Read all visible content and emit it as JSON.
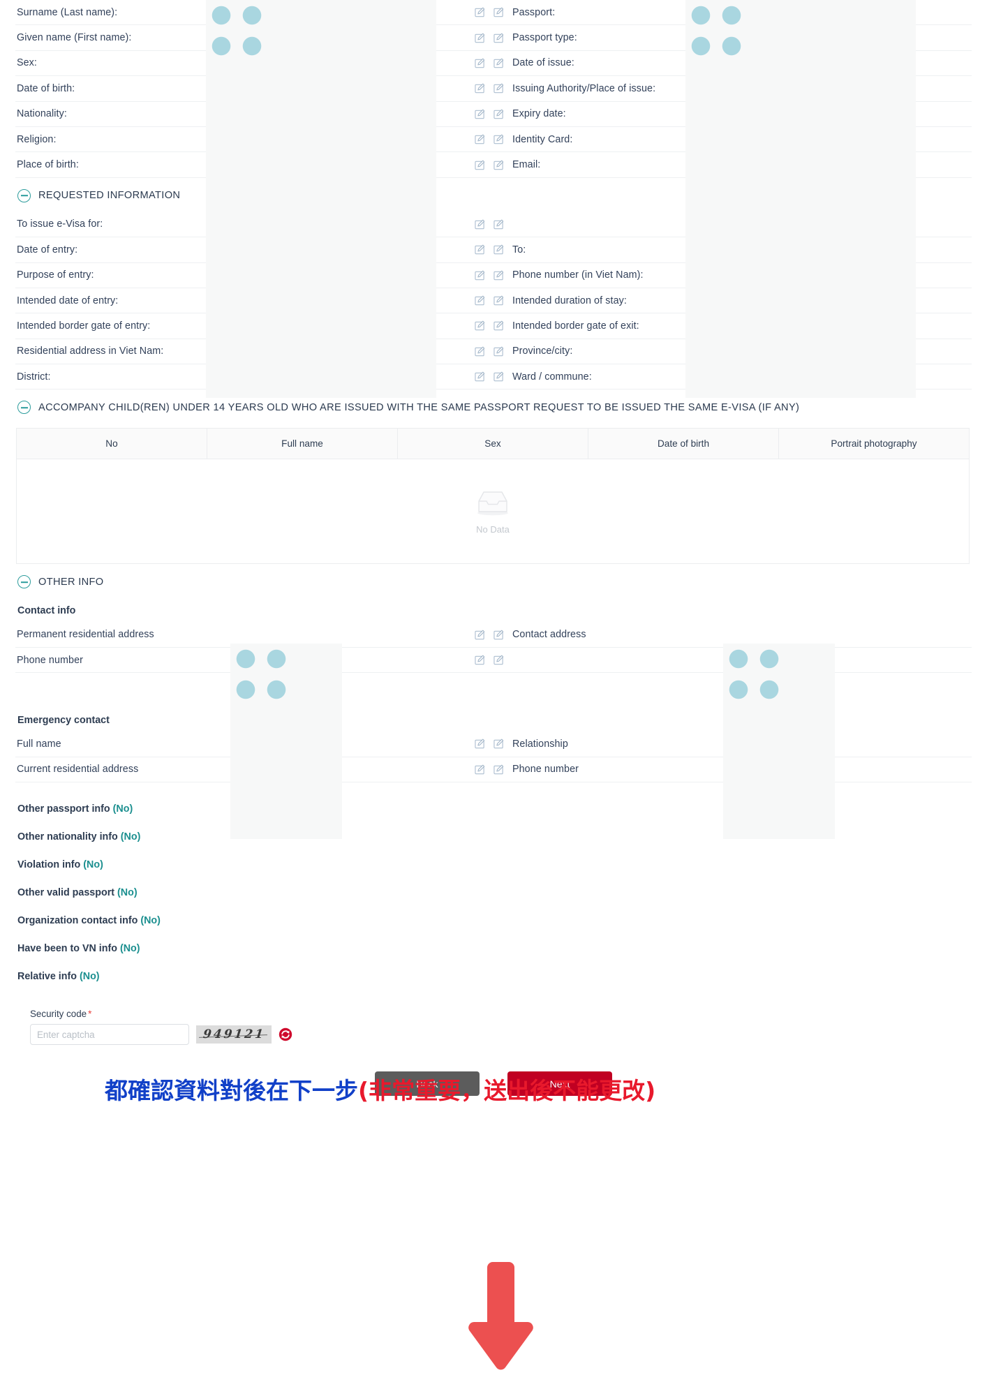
{
  "personal_left": [
    "Surname (Last name):",
    "Given name (First name):",
    "Sex:",
    "Date of birth:",
    "Nationality:",
    "Religion:",
    "Place of birth:"
  ],
  "personal_right": [
    "Passport:",
    "Passport type:",
    "Date of issue:",
    "Issuing Authority/Place of issue:",
    "Expiry date:",
    "Identity Card:",
    "Email:"
  ],
  "requested_section": {
    "title": "REQUESTED INFORMATION",
    "left": [
      "To issue e-Visa for:",
      "Date of entry:",
      "Purpose of entry:",
      "Intended date of entry:",
      "Intended border gate of entry:",
      "Residential address in Viet Nam:",
      "District:"
    ],
    "right": [
      "",
      "To:",
      "Phone number (in Viet Nam):",
      "Intended duration of stay:",
      "Intended border gate of exit:",
      "Province/city:",
      "Ward / commune:"
    ]
  },
  "accompany_section": {
    "title": "ACCOMPANY CHILD(REN) UNDER 14 YEARS OLD WHO ARE ISSUED WITH THE SAME PASSPORT REQUEST TO BE ISSUED THE SAME E-VISA (IF ANY)",
    "columns": [
      "No",
      "Full name",
      "Sex",
      "Date of birth",
      "Portrait photography"
    ],
    "rows": [],
    "empty_text": "No Data"
  },
  "other_info": {
    "title": "OTHER INFO",
    "contact_heading": "Contact info",
    "contact_left": [
      "Permanent residential address",
      "Phone number"
    ],
    "contact_right": [
      "Contact address",
      ""
    ],
    "emergency_heading": "Emergency contact",
    "emergency_left": [
      "Full name",
      "Current residential address"
    ],
    "emergency_right": [
      "Relationship",
      "Phone number"
    ]
  },
  "flag_items": [
    {
      "label": "Other passport info",
      "value": "(No)"
    },
    {
      "label": "Other nationality info",
      "value": "(No)"
    },
    {
      "label": "Violation info",
      "value": "(No)"
    },
    {
      "label": "Other valid passport",
      "value": "(No)"
    },
    {
      "label": "Organization contact info",
      "value": "(No)"
    },
    {
      "label": "Have been to VN info",
      "value": "(No)"
    },
    {
      "label": "Relative info",
      "value": "(No)"
    }
  ],
  "annotation": {
    "blue_text": "都確認資料對後在下一步",
    "red_text": "(非常重要，送出後不能更改)"
  },
  "security": {
    "label": "Security code",
    "required_mark": "*",
    "placeholder": "Enter captcha",
    "value": "",
    "captcha_text": "949121",
    "refresh_icon": "refresh-icon"
  },
  "buttons": {
    "back": "Back",
    "next": "Next"
  },
  "colors": {
    "accent_teal": "#1b8f8f",
    "next_red": "#c00022",
    "back_gray": "#5c5c5c",
    "annotation_blue": "#1140c8",
    "annotation_red": "#e8192c",
    "arrow_red": "#ec5050",
    "pattern_blue": "#a9d6e0"
  }
}
